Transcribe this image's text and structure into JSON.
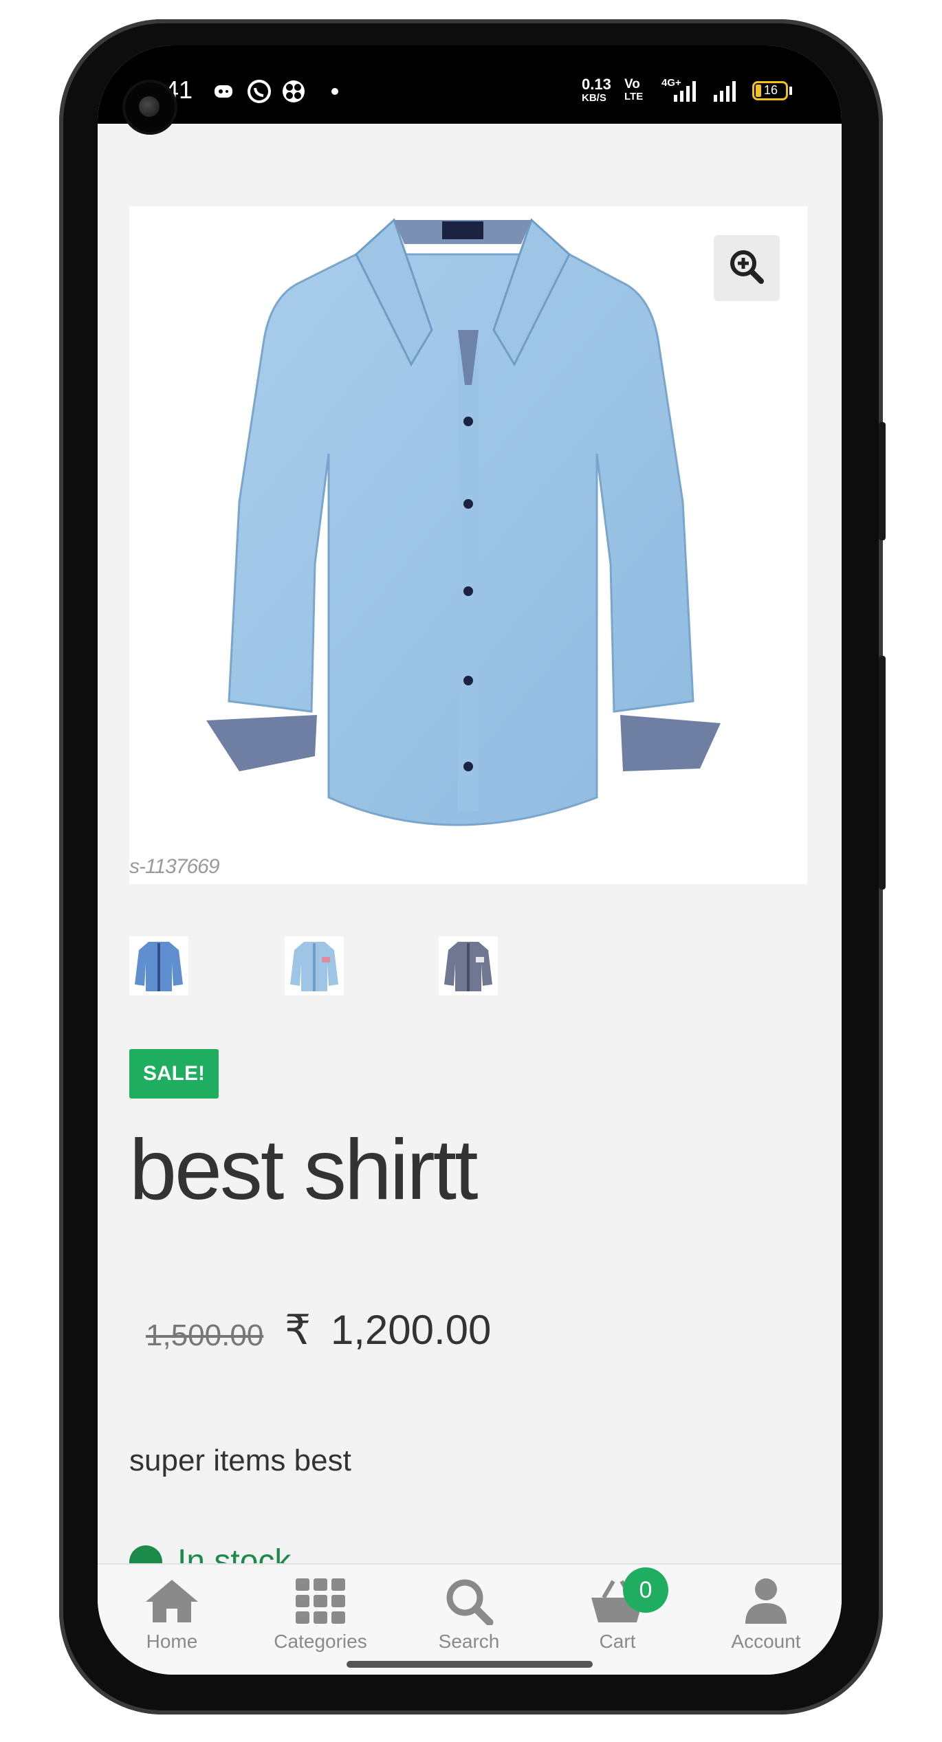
{
  "status_bar": {
    "time": "9:41",
    "net_speed_value": "0.13",
    "net_speed_unit": "KB/S",
    "volte_top": "Vo",
    "volte_bottom": "LTE",
    "network_type": "4G+",
    "battery": "16"
  },
  "product": {
    "sku_watermark": "s-1137669",
    "sale_badge": "SALE!",
    "title": "best shirtt",
    "old_price": "1,500.00",
    "currency": "₹",
    "price": "1,200.00",
    "description": "super items best",
    "stock": "In stock"
  },
  "bottom_nav": {
    "home": "Home",
    "categories": "Categories",
    "search": "Search",
    "cart": "Cart",
    "cart_count": "0",
    "account": "Account"
  },
  "colors": {
    "accent": "#1fad5f",
    "stock_text": "#1b8a4a",
    "nav_icon": "#8a8a8a"
  },
  "icons": [
    "zoom-in-icon",
    "home-icon",
    "grid-icon",
    "search-icon",
    "basket-icon",
    "user-icon",
    "whatsapp-icon",
    "battery-icon",
    "signal-icon"
  ]
}
